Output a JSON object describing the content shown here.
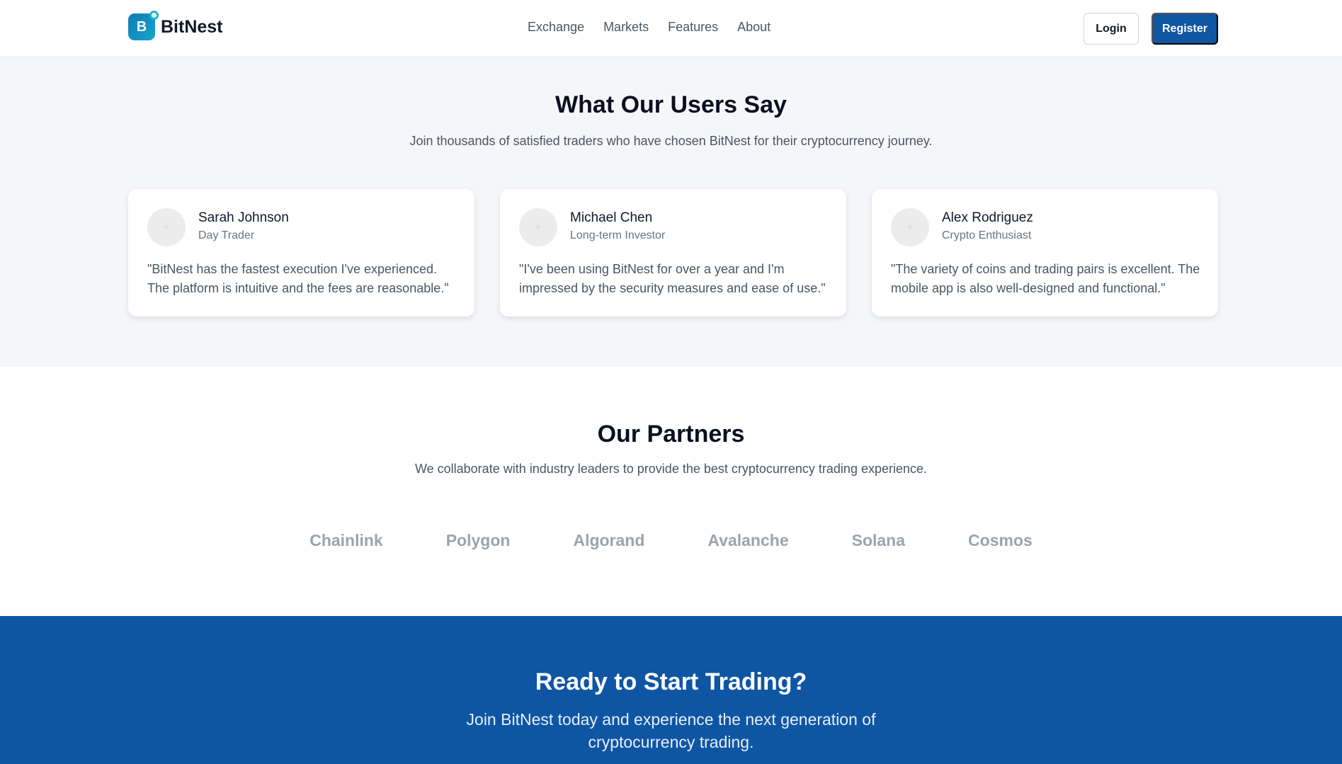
{
  "header": {
    "logo_letter": "B",
    "logo_text": "BitNest",
    "nav": [
      "Exchange",
      "Markets",
      "Features",
      "About"
    ],
    "login_label": "Login",
    "register_label": "Register"
  },
  "testimonials": {
    "title": "What Our Users Say",
    "subtitle": "Join thousands of satisfied traders who have chosen BitNest for their cryptocurrency journey.",
    "cards": [
      {
        "name": "Sarah Johnson",
        "role": "Day Trader",
        "quote": "\"BitNest has the fastest execution I've experienced. The platform is intuitive and the fees are reasonable.\""
      },
      {
        "name": "Michael Chen",
        "role": "Long-term Investor",
        "quote": "\"I've been using BitNest for over a year and I'm impressed by the security measures and ease of use.\""
      },
      {
        "name": "Alex Rodriguez",
        "role": "Crypto Enthusiast",
        "quote": "\"The variety of coins and trading pairs is excellent. The mobile app is also well-designed and functional.\""
      }
    ]
  },
  "partners": {
    "title": "Our Partners",
    "subtitle": "We collaborate with industry leaders to provide the best cryptocurrency trading experience.",
    "names": [
      "Chainlink",
      "Polygon",
      "Algorand",
      "Avalanche",
      "Solana",
      "Cosmos"
    ]
  },
  "cta": {
    "title": "Ready to Start Trading?",
    "subtitle": "Join BitNest today and experience the next generation of cryptocurrency trading."
  },
  "colors": {
    "brand": "#0f56a3",
    "section_bg": "#f5f6f9",
    "partner_text": "#9ca3af"
  }
}
